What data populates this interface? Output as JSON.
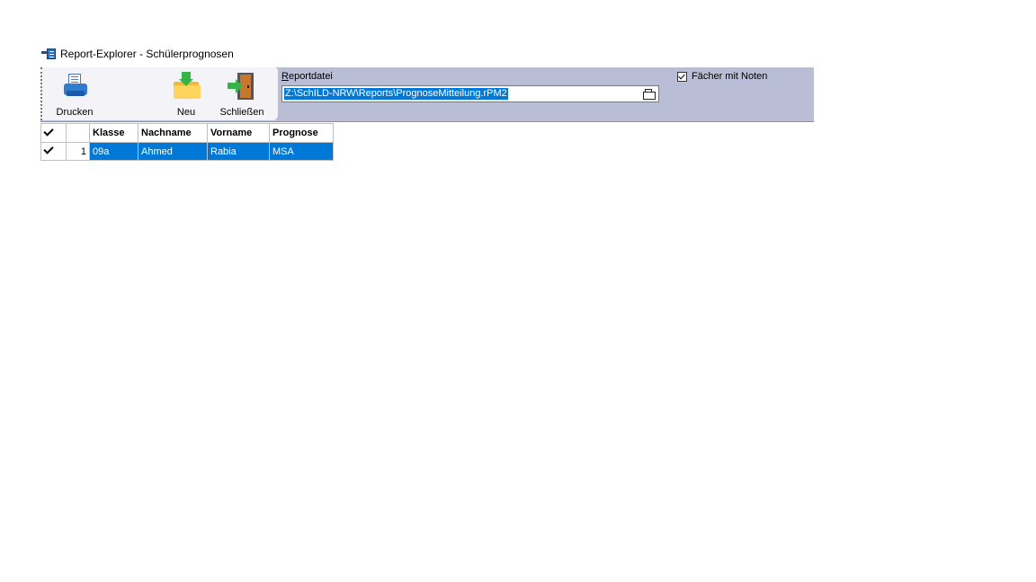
{
  "window": {
    "title": "Report-Explorer - Schülerprognosen"
  },
  "toolbar": {
    "print_label": "Drucken",
    "new_label": "Neu",
    "close_label": "Schließen"
  },
  "report": {
    "label_accel": "R",
    "label_rest": "eportdatei",
    "path": "Z:\\SchILD-NRW\\Reports\\PrognoseMitteilung.rPM2"
  },
  "options": {
    "faecher_mit_noten_label": "Fächer mit Noten",
    "faecher_mit_noten_checked": true
  },
  "grid": {
    "columns": [
      "Klasse",
      "Nachname",
      "Vorname",
      "Prognose"
    ],
    "rows": [
      {
        "checked": true,
        "index": "1",
        "klasse": "09a",
        "nachname": "Ahmed",
        "vorname": "Rabia",
        "prognose": "MSA"
      }
    ]
  },
  "colors": {
    "ribbon_bg": "#b9bdd6",
    "selection": "#0078d7"
  }
}
